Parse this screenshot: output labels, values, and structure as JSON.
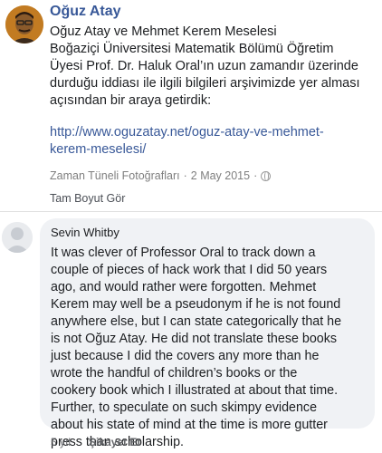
{
  "post": {
    "author": "Oğuz Atay",
    "text_lines": [
      "Oğuz Atay ve Mehmet Kerem Meselesi",
      "Boğaziçi Üniversitesi Matematik Bölümü Öğretim",
      "Üyesi Prof. Dr. Haluk Oral’ın uzun zamandır üzerinde",
      "durduğu iddiası ile ilgili bilgileri arşivimizde yer alması",
      "açısından bir araya getirdik:"
    ],
    "link_lines": [
      "http://www.oguzatay.net/oguz-atay-ve-mehmet-",
      "kerem-meselesi/"
    ],
    "album": "Zaman Tüneli Fotoğrafları",
    "separator": "·",
    "date": "2 May 2015",
    "privacy_icon": "globe-icon",
    "full_size_link": "Tam Boyut Gör"
  },
  "comment": {
    "author": "Sevin Whitby",
    "text_lines": [
      "It was clever of Professor Oral to track down a",
      "couple of pieces of hack work that I did 50 years",
      "ago, and would rather were forgotten. Mehmet",
      "Kerem may well be a pseudonym if he is not found",
      "anywhere else, but I can state categorically that he",
      "is not Oğuz Atay. He did not translate these books",
      "just because I did the covers any more than he",
      "wrote the handful of children’s books or the",
      "cookery book which I illustrated at about that time.",
      "Further, to speculate on such skimpy evidence",
      "about his state of mind at the time is more gutter",
      "press than scholarship."
    ],
    "age": "5 yıl",
    "report": "Şikayet Et"
  },
  "colors": {
    "link": "#385898",
    "bubble": "#f0f2f5",
    "muted": "#7f7f7f"
  }
}
